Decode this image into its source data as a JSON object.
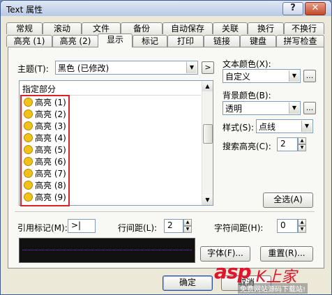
{
  "window": {
    "title": "Text 属性",
    "help_label": "?",
    "close_label": "✕"
  },
  "tabs_row1": [
    {
      "label": "常规"
    },
    {
      "label": "滚动"
    },
    {
      "label": "文件"
    },
    {
      "label": "备份"
    },
    {
      "label": "自动保存"
    },
    {
      "label": "关联"
    },
    {
      "label": "换行"
    },
    {
      "label": "不换行"
    }
  ],
  "tabs_row2": [
    {
      "label": "高亮 (1)"
    },
    {
      "label": "高亮 (2)"
    },
    {
      "label": "显示"
    },
    {
      "label": "标记"
    },
    {
      "label": "打印"
    },
    {
      "label": "链接"
    },
    {
      "label": "键盘"
    },
    {
      "label": "拼写检查"
    }
  ],
  "active_tab": "显示",
  "theme": {
    "label": "主题(T):",
    "value": "黑色 (已修改)",
    "next_label": ">"
  },
  "list": {
    "header": "指定部分",
    "items": [
      {
        "label": "高亮 (1)"
      },
      {
        "label": "高亮 (2)"
      },
      {
        "label": "高亮 (3)"
      },
      {
        "label": "高亮 (4)"
      },
      {
        "label": "高亮 (5)"
      },
      {
        "label": "高亮 (6)"
      },
      {
        "label": "高亮 (7)"
      },
      {
        "label": "高亮 (8)"
      },
      {
        "label": "高亮 (9)"
      }
    ]
  },
  "text_color": {
    "label": "文本颜色(X):",
    "value": "自定义",
    "more_label": "..."
  },
  "bg_color": {
    "label": "背景颜色(B):",
    "value": "透明",
    "more_label": "..."
  },
  "style": {
    "label": "样式(S):",
    "value": "点线"
  },
  "search_highlight": {
    "label": "搜索高亮(C):",
    "value": "2"
  },
  "select_all_label": "全选(A)",
  "ref_mark": {
    "label": "引用标记(M):",
    "value": ">|"
  },
  "line_spacing": {
    "label": "行间距(L):",
    "value": "2"
  },
  "char_spacing": {
    "label": "字符间距(H):",
    "value": "0"
  },
  "font_button": "字体(F)...",
  "reset_button": "重置(R)...",
  "ok_button": "确定",
  "cancel_button": "取消",
  "watermark": {
    "brand": "asp",
    "logo": "K上家",
    "sub": "免费网站源码下载站!"
  },
  "colors": {
    "highlight_box": "#d8232a",
    "preview_bg": "#111111",
    "preview_line": "#7b3fb0"
  }
}
